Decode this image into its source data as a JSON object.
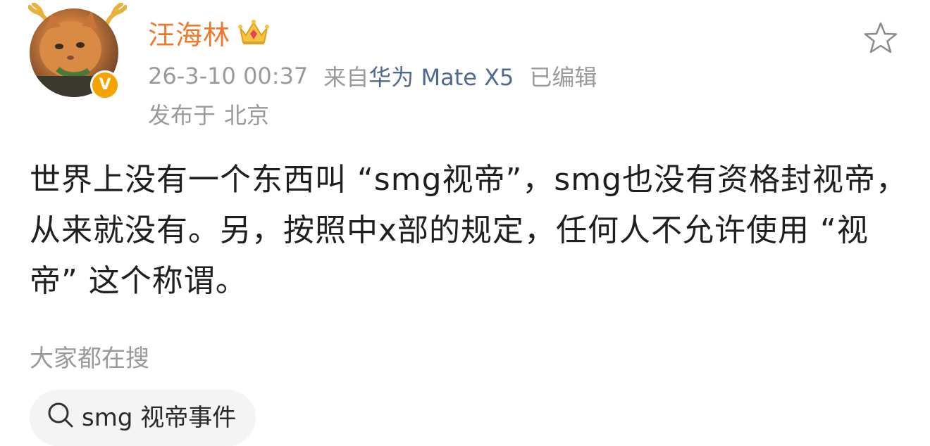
{
  "user": {
    "name": "汪海林",
    "verified_badge": "V",
    "avatar_icon": "cat-avatar",
    "crown_icon": "crown-icon"
  },
  "meta": {
    "time": "26-3-10 00:37",
    "from": "来自",
    "device": "华为 Mate X5",
    "edited": "已编辑",
    "location_prefix": "发布于",
    "location": "北京"
  },
  "actions": {
    "favorite_icon": "star-icon"
  },
  "post": {
    "text": "世界上没有一个东西叫 “smg视帝”，smg也没有资格封视帝，从来就没有。另，按照中x部的规定，任何人不允许使用 “视帝” 这个称谓。"
  },
  "search": {
    "title": "大家都在搜",
    "chip_label": "smg 视帝事件",
    "chip_icon": "search-icon"
  },
  "colors": {
    "username": "#f0782c",
    "device": "#4e6a91",
    "meta": "#9a9a9a",
    "badge": "#f5a300"
  }
}
